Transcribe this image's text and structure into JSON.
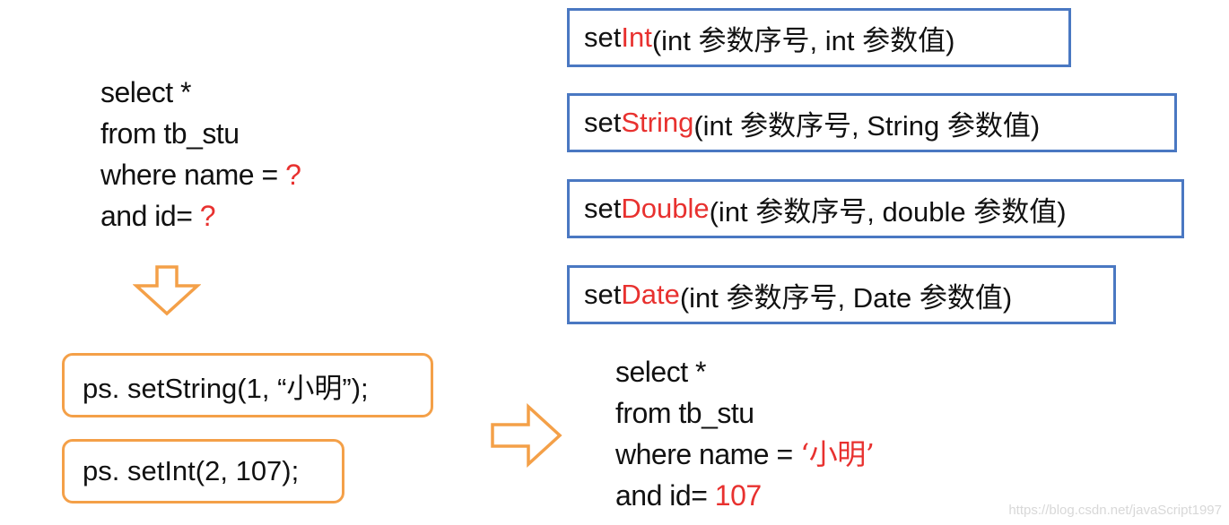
{
  "query_template": {
    "lines": [
      {
        "text": "select *",
        "param": ""
      },
      {
        "text": "from tb_stu",
        "param": ""
      },
      {
        "text": "where name = ",
        "param": "?"
      },
      {
        "text": "and id= ",
        "param": "?"
      }
    ]
  },
  "setter_methods": [
    {
      "prefix": "set",
      "type": "Int",
      "args": "(int 参数序号, int 参数值)"
    },
    {
      "prefix": "set",
      "type": "String",
      "args": "(int 参数序号, String 参数值)"
    },
    {
      "prefix": "set",
      "type": "Double",
      "args": "(int 参数序号, double 参数值)"
    },
    {
      "prefix": "set",
      "type": "Date",
      "args": "(int 参数序号, Date 参数值)"
    }
  ],
  "calls": [
    "ps. setString(1, “小明”);",
    "ps. setInt(2, 107);"
  ],
  "query_result": {
    "lines": [
      {
        "text": "select *",
        "param": ""
      },
      {
        "text": "from tb_stu",
        "param": ""
      },
      {
        "text": "where name = ",
        "param": "‘小明’"
      },
      {
        "text": "and id= ",
        "param": "107"
      }
    ]
  },
  "colors": {
    "highlight": "#e8312f",
    "method_border": "#4a78c2",
    "call_border": "#f4a048",
    "arrow": "#f4a048"
  },
  "watermark": "https://blog.csdn.net/javaScript1997"
}
